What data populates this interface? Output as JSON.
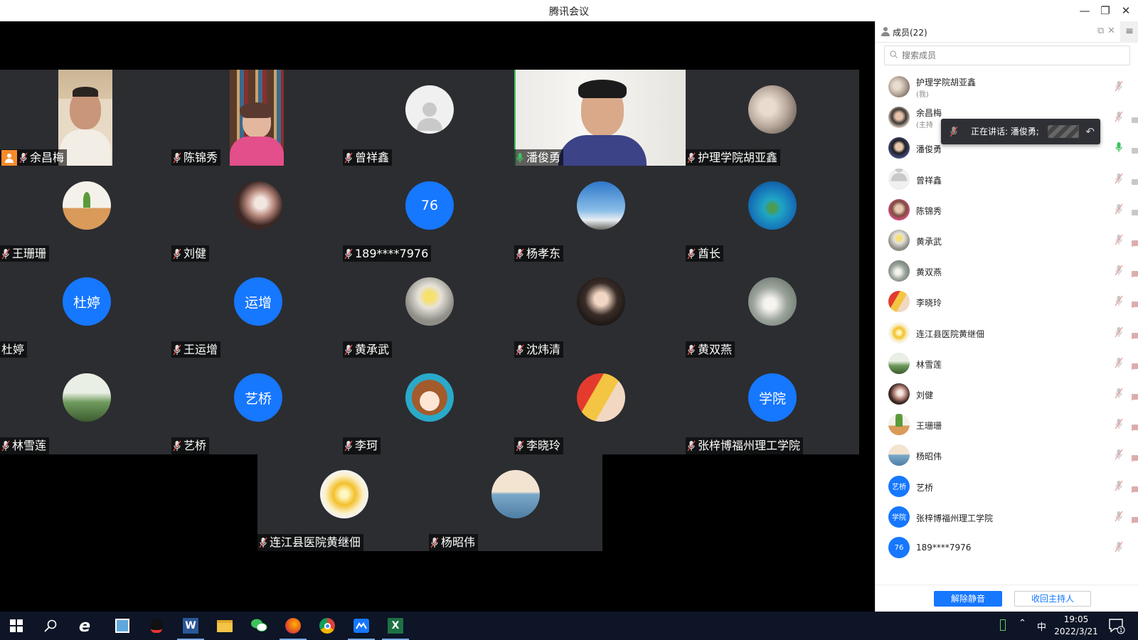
{
  "window": {
    "title": "腾讯会议",
    "minimize_icon": "minimize-icon",
    "restore_icon": "restore-icon",
    "close_icon": "close-icon"
  },
  "tiles": [
    {
      "name": "余昌梅",
      "kind": "video",
      "host": true
    },
    {
      "name": "陈锦秀",
      "kind": "video"
    },
    {
      "name": "曾祥鑫",
      "kind": "default-avatar"
    },
    {
      "name": "潘俊勇",
      "kind": "video",
      "speaking": true
    },
    {
      "name": "护理学院胡亚鑫",
      "kind": "photo"
    },
    {
      "name": "王珊珊",
      "kind": "photo"
    },
    {
      "name": "刘健",
      "kind": "photo"
    },
    {
      "name": "189****7976",
      "kind": "text",
      "avatar_text": "76"
    },
    {
      "name": "杨孝东",
      "kind": "photo"
    },
    {
      "name": "酋长",
      "kind": "photo"
    },
    {
      "name": "杜婷",
      "kind": "text",
      "avatar_text": "杜婷",
      "no_mic": true
    },
    {
      "name": "王运增",
      "kind": "text",
      "avatar_text": "运增"
    },
    {
      "name": "黄承武",
      "kind": "photo"
    },
    {
      "name": "沈炜清",
      "kind": "photo"
    },
    {
      "name": "黄双燕",
      "kind": "photo"
    },
    {
      "name": "林雪莲",
      "kind": "photo"
    },
    {
      "name": "艺桥",
      "kind": "text",
      "avatar_text": "艺桥"
    },
    {
      "name": "李珂",
      "kind": "photo"
    },
    {
      "name": "李晓玲",
      "kind": "photo"
    },
    {
      "name": "张梓博福州理工学院",
      "kind": "text",
      "avatar_text": "学院"
    },
    {
      "name": "连江县医院黄继佃",
      "kind": "photo"
    },
    {
      "name": "杨昭伟",
      "kind": "photo"
    }
  ],
  "sidebar": {
    "title": "成员(22)",
    "search_placeholder": "搜索成员",
    "tooltip": "正在讲话: 潘俊勇;",
    "members": [
      {
        "name": "护理学院胡亚鑫",
        "sub": "(我)",
        "mic": "muted",
        "cam": "none"
      },
      {
        "name": "余昌梅",
        "sub": "(主持",
        "mic": "muted",
        "cam": "on"
      },
      {
        "name": "潘俊勇",
        "mic": "speaking",
        "cam": "on"
      },
      {
        "name": "曾祥鑫",
        "mic": "muted",
        "cam": "on"
      },
      {
        "name": "陈锦秀",
        "mic": "muted",
        "cam": "on"
      },
      {
        "name": "黄承武",
        "mic": "muted",
        "cam": "off"
      },
      {
        "name": "黄双燕",
        "mic": "muted",
        "cam": "off"
      },
      {
        "name": "李晓玲",
        "mic": "muted",
        "cam": "off"
      },
      {
        "name": "连江县医院黄继佃",
        "mic": "muted",
        "cam": "off"
      },
      {
        "name": "林雪莲",
        "mic": "muted",
        "cam": "off"
      },
      {
        "name": "刘健",
        "mic": "muted",
        "cam": "off"
      },
      {
        "name": "王珊珊",
        "mic": "muted",
        "cam": "off"
      },
      {
        "name": "杨昭伟",
        "mic": "muted",
        "cam": "off"
      },
      {
        "name": "艺桥",
        "avatar_text": "艺桥",
        "mic": "muted",
        "cam": "off"
      },
      {
        "name": "张梓博福州理工学院",
        "avatar_text": "学院",
        "mic": "muted",
        "cam": "off"
      },
      {
        "name": "189****7976",
        "avatar_text": "76",
        "mic": "muted",
        "cam": "none"
      }
    ],
    "unmute_all_label": "解除静音",
    "reclaim_host_label": "收回主持人"
  },
  "taskbar": {
    "ime": "中",
    "time": "19:05",
    "date": "2022/3/21",
    "notification_count": "1"
  },
  "colors": {
    "accent": "#1677ff",
    "speaking": "#3ec25e",
    "host_badge": "#f68b2c",
    "tile_bg": "#2b2d31"
  }
}
